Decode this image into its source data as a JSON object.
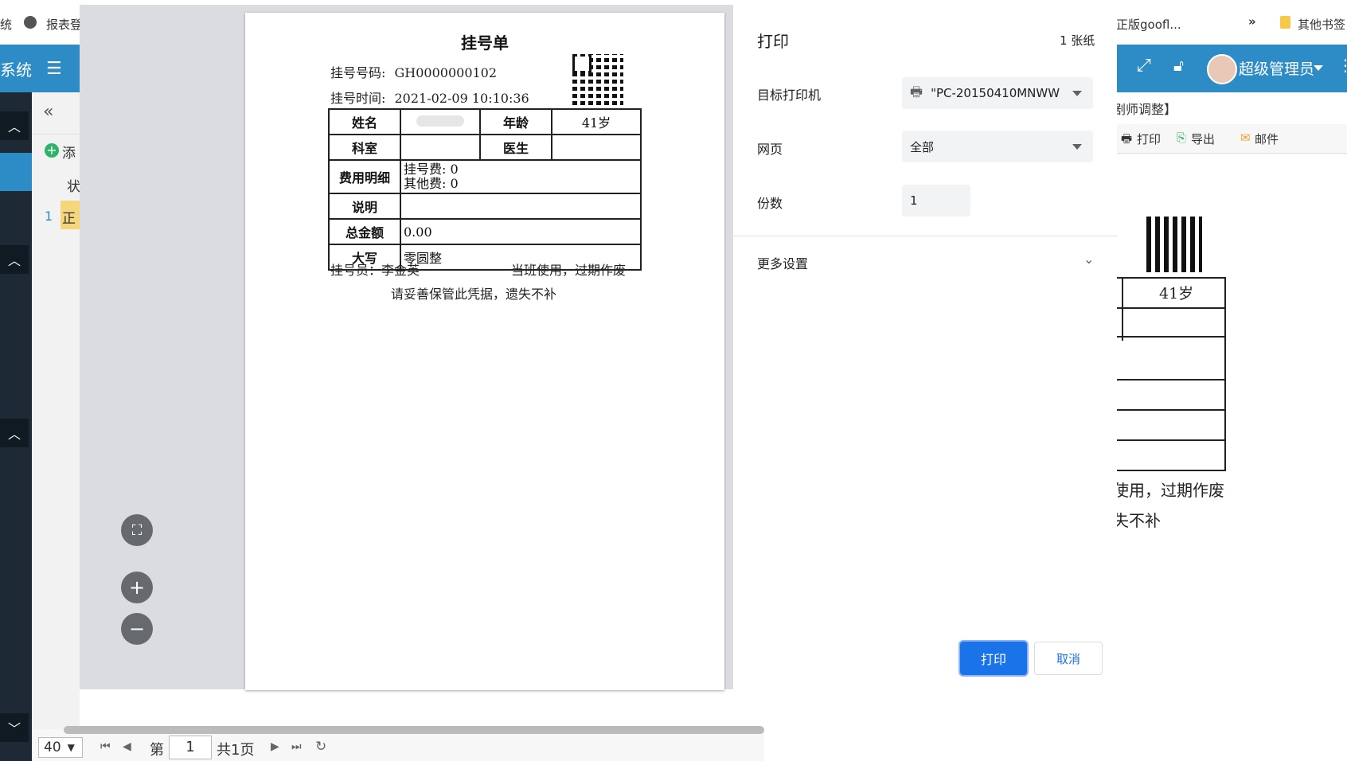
{
  "browser": {
    "bookmarks": {
      "left_partial": "统",
      "item_report": "报表登",
      "item_goofl": "正版goofl...",
      "overflow": "»",
      "other_bookmarks": "其他书签"
    }
  },
  "app": {
    "title_partial": "系统",
    "user_name": "超级管理员",
    "tab_partial": "剧师调整】",
    "toolbar": {
      "add_partial": "添",
      "print": "打印",
      "export": "导出",
      "mail": "邮件"
    },
    "table": {
      "col_status_partial": "状",
      "row_index": "1",
      "row_status_partial": "正"
    },
    "bg_receipt": {
      "age": "41岁",
      "footer_line1_partial": "使用，过期作废",
      "footer_line2_partial": "失不补"
    },
    "pager": {
      "page_size": "40",
      "page_prefix": "第",
      "page_current": "1",
      "page_total": "共1页"
    }
  },
  "print_preview": {
    "receipt": {
      "title": "挂号单",
      "reg_no_label": "挂号号码:",
      "reg_no_value": "GH0000000102",
      "reg_time_label": "挂号时间:",
      "reg_time_value": "2021-02-09 10:10:36",
      "name_label": "姓名",
      "age_label": "年龄",
      "age_value": "41岁",
      "dept_label": "科室",
      "doctor_label": "医生",
      "fee_detail_label": "费用明细",
      "fee_reg": "挂号费: 0",
      "fee_other": "其他费: 0",
      "note_label": "说明",
      "total_label": "总金额",
      "total_value": "0.00",
      "capital_label": "大写",
      "capital_value": "零圆整",
      "operator": "挂号员：李金英",
      "shift_note": "当班使用，过期作废",
      "keep_note": "请妥善保管此凭据，遗失不补"
    }
  },
  "print_settings": {
    "title": "打印",
    "sheet_count": "1 张纸",
    "printer_label": "目标打印机",
    "printer_value": "\"PC-20150410MNWW",
    "pages_label": "网页",
    "pages_value": "全部",
    "copies_label": "份数",
    "copies_value": "1",
    "more_settings": "更多设置",
    "print_button": "打印",
    "cancel_button": "取消"
  },
  "colors": {
    "header_blue": "#2d8cc6",
    "print_button_blue": "#1a73e8",
    "sidebar_dark": "#1d2a35"
  }
}
